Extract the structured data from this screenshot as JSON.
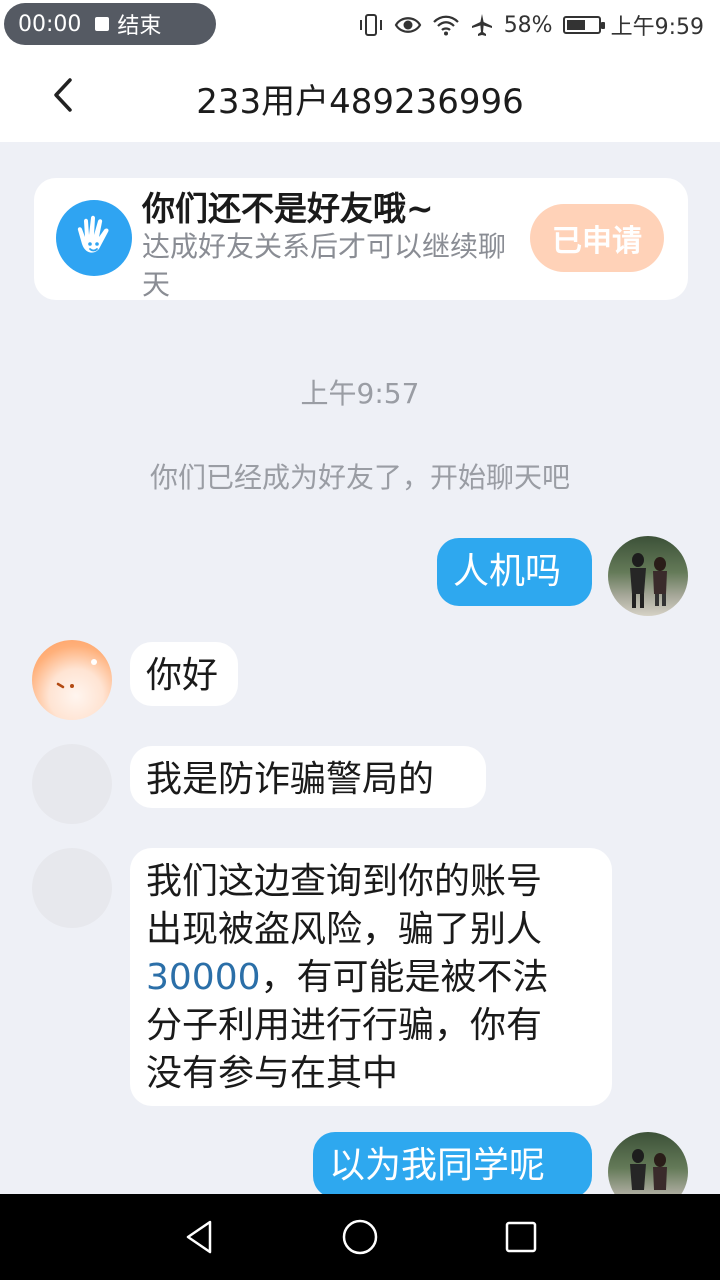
{
  "status_bar": {
    "recording_time": "00:00",
    "end_label": "结束",
    "battery": "58%",
    "time": "上午9:59"
  },
  "header": {
    "title": "233用户489236996"
  },
  "friend_banner": {
    "title": "你们还不是好友哦~",
    "subtitle": "达成好友关系后才可以继续聊天",
    "button_label": "已申请"
  },
  "chat": {
    "timestamp": "上午9:57",
    "system_message": "你们已经成为好友了，开始聊天吧",
    "messages": [
      {
        "direction": "out",
        "text": "人机吗"
      },
      {
        "direction": "in",
        "text": "你好"
      },
      {
        "direction": "in",
        "text": "我是防诈骗警局的"
      },
      {
        "direction": "in",
        "lines": [
          "我们这边查询到你的账号",
          "出现被盗风险，骗了别人"
        ],
        "line3_num": "30000",
        "line3_rest": "，有可能是被不法",
        "line4": "分子利用进行行骗，你有",
        "line5": "没有参与在其中"
      },
      {
        "direction": "out",
        "text": "以为我同学呢"
      }
    ]
  },
  "icons": {
    "back": "chevron-left-icon",
    "hand": "hand-wave-icon",
    "nav_back": "triangle-back-icon",
    "nav_home": "circle-home-icon",
    "nav_recents": "square-recents-icon"
  },
  "colors": {
    "accent_blue": "#2ea8ef",
    "applied_button": "#ffd2b8",
    "background": "#eef0f6"
  }
}
